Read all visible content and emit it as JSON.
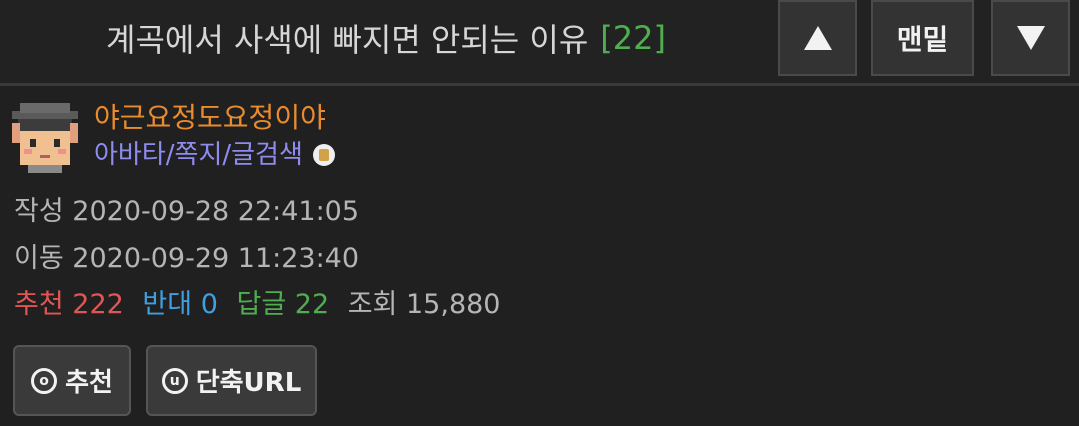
{
  "header": {
    "title": "계곡에서 사색에 빠지면 안되는 이유",
    "comment_count": "[22]",
    "up_icon": "triangle-up-icon",
    "bottom_label": "맨밑",
    "down_icon": "triangle-down-icon"
  },
  "author": {
    "avatar_icon": "pixel-avatar-graduate",
    "name": "야근요정도요정이야",
    "links": "아바타/쪽지/글검색",
    "badge_icon": "badge-icon"
  },
  "meta": {
    "created_label": "작성",
    "created_value": "2020-09-28 22:41:05",
    "moved_label": "이동",
    "moved_value": "2020-09-29 11:23:40"
  },
  "stats": {
    "recommend_label": "추천",
    "recommend_value": "222",
    "oppose_label": "반대",
    "oppose_value": "0",
    "reply_label": "답글",
    "reply_value": "22",
    "views_label": "조회",
    "views_value": "15,880"
  },
  "actions": {
    "recommend_icon_glyph": "o",
    "recommend_label": "추천",
    "shorturl_icon_glyph": "u",
    "shorturl_label": "단축URL"
  },
  "colors": {
    "background": "#202020",
    "author_name": "#e98b2e",
    "links": "#8f8cf0",
    "recommend": "#e25555",
    "oppose": "#3f9fe0",
    "reply": "#4fae4f"
  }
}
